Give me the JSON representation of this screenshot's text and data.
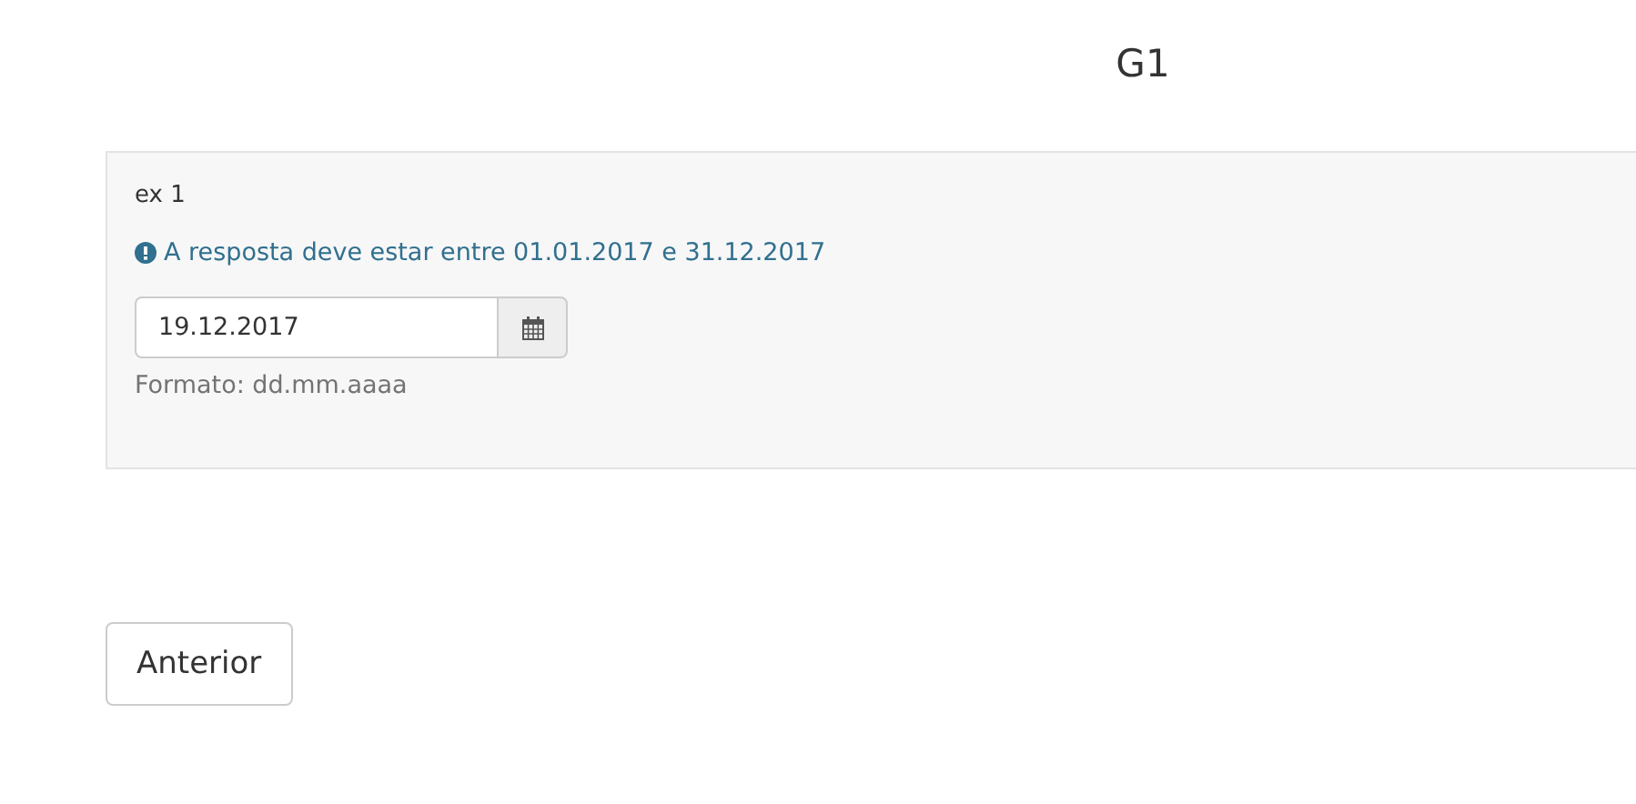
{
  "title": "G1",
  "question": {
    "label": "ex 1",
    "hint": "A resposta deve estar entre 01.01.2017 e 31.12.2017",
    "value": "19.12.2017",
    "format_note": "Formato: dd.mm.aaaa"
  },
  "buttons": [
    "Anterior"
  ]
}
